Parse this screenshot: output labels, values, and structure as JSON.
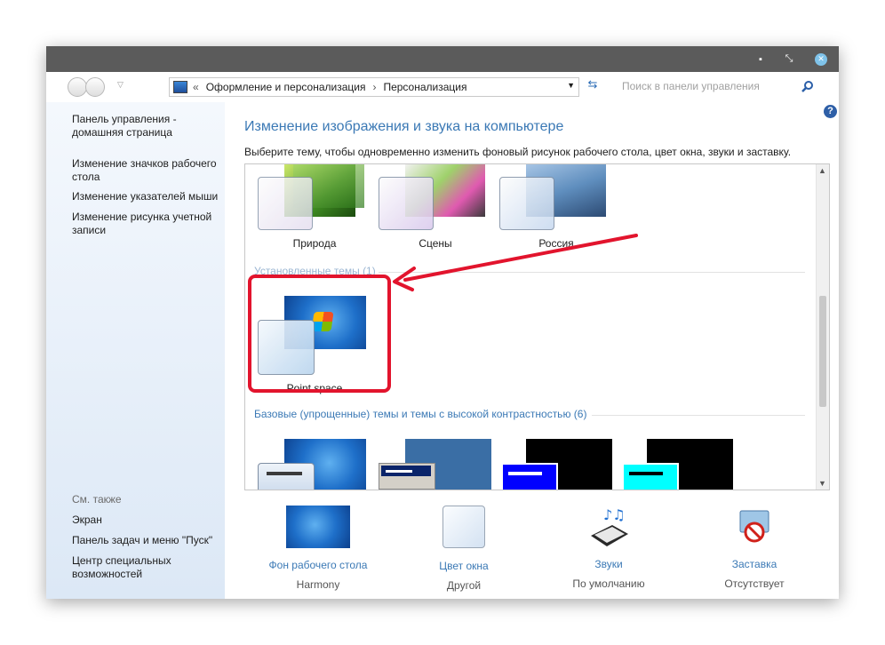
{
  "window": {
    "controls": {
      "minimize": "▪",
      "restore": "⤡",
      "close": "✕"
    }
  },
  "navbar": {
    "breadcrumb_sep_left": "«",
    "breadcrumb": [
      "Оформление и персонализация",
      "Персонализация"
    ],
    "search_placeholder": "Поиск в панели управления"
  },
  "sidebar": {
    "links": [
      "Панель управления - домашняя страница",
      "Изменение значков рабочего стола",
      "Изменение указателей мыши",
      "Изменение рисунка учетной записи"
    ],
    "see_also_title": "См. также",
    "see_also": [
      "Экран",
      "Панель задач и меню \"Пуск\"",
      "Центр специальных возможностей"
    ]
  },
  "main": {
    "title": "Изменение изображения и звука на компьютере",
    "subtitle": "Выберите тему, чтобы одновременно изменить фоновый рисунок рабочего стола, цвет окна, звуки и заставку.",
    "themes_top": [
      "Природа",
      "Сцены",
      "Россия"
    ],
    "installed_header": "Установленные темы (1)",
    "installed_theme": "Point space",
    "basic_header": "Базовые (упрощенные) темы и темы с высокой контрастностью (6)"
  },
  "bottom": [
    {
      "link": "Фон рабочего стола",
      "value": "Harmony"
    },
    {
      "link": "Цвет окна",
      "value": "Другой"
    },
    {
      "link": "Звуки",
      "value": "По умолчанию"
    },
    {
      "link": "Заставка",
      "value": "Отсутствует"
    }
  ],
  "colors": {
    "accent": "#3b79b5",
    "highlight": "#e2142d",
    "titlebar": "#5b5b5b"
  }
}
